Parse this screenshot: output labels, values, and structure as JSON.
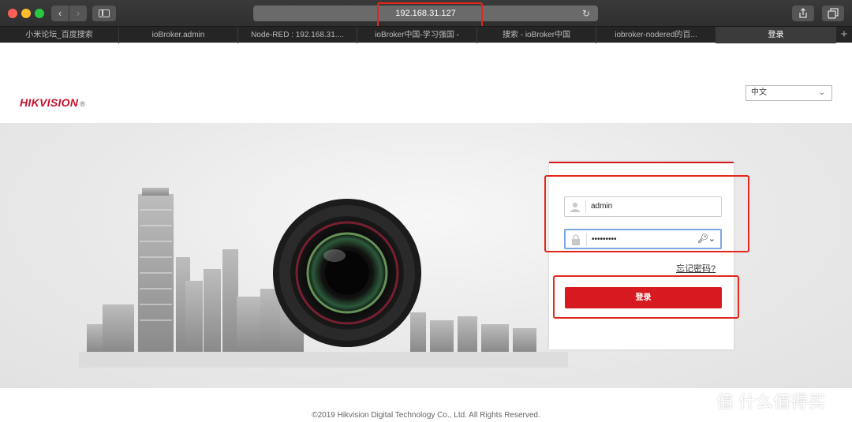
{
  "browser": {
    "url": "192.168.31.127",
    "tabs": [
      {
        "label": "小米论坛_百度搜索"
      },
      {
        "label": "ioBroker.admin"
      },
      {
        "label": "Node-RED : 192.168.31...."
      },
      {
        "label": "ioBroker中国-学习强国 -"
      },
      {
        "label": "搜索 - ioBroker中国"
      },
      {
        "label": "iobroker-nodered的百..."
      },
      {
        "label": "登录"
      }
    ],
    "new_tab": "+"
  },
  "page": {
    "logo": "HIKVISION",
    "logo_reg": "®",
    "language": "中文",
    "login": {
      "username": "admin",
      "password_mask": "•••••••••",
      "forgot": "忘记密码?",
      "submit": "登录"
    },
    "footer": "©2019 Hikvision Digital Technology Co., Ltd. All Rights Reserved."
  },
  "watermark": "值 什么值得买",
  "colors": {
    "accent": "#d71920",
    "annotation": "#e3271c"
  }
}
